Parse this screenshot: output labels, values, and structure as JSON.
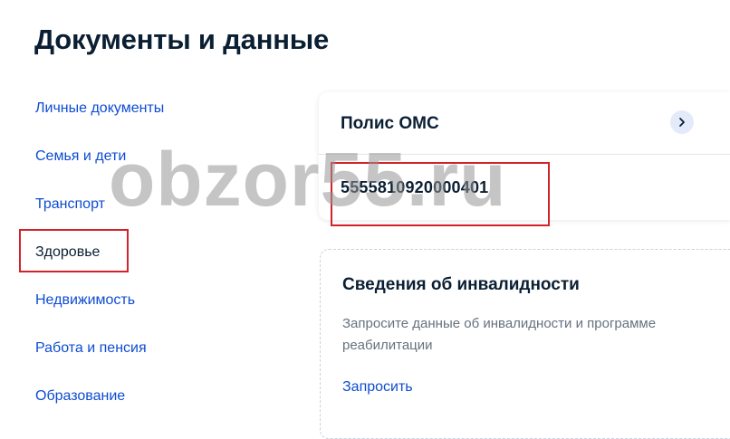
{
  "page": {
    "title": "Документы и данные"
  },
  "sidebar": {
    "items": [
      {
        "label": "Личные документы"
      },
      {
        "label": "Семья и дети"
      },
      {
        "label": "Транспорт"
      },
      {
        "label": "Здоровье"
      },
      {
        "label": "Недвижимость"
      },
      {
        "label": "Работа и пенсия"
      },
      {
        "label": "Образование"
      }
    ],
    "active": "Здоровье"
  },
  "oms_card": {
    "title": "Полис ОМС",
    "number": "5555810920000401",
    "open_icon": "chevron-right-icon"
  },
  "disability_card": {
    "title": "Сведения об инвалидности",
    "description": "Запросите данные об инвалидности и программе реабилитации",
    "action_label": "Запросить"
  },
  "watermark": {
    "text": "obzor55.ru"
  },
  "colors": {
    "link": "#0d4cd3",
    "text": "#0b1f33",
    "muted": "#66727f",
    "highlight": "#d2232a",
    "chevron_bg": "#e3ebfa"
  }
}
